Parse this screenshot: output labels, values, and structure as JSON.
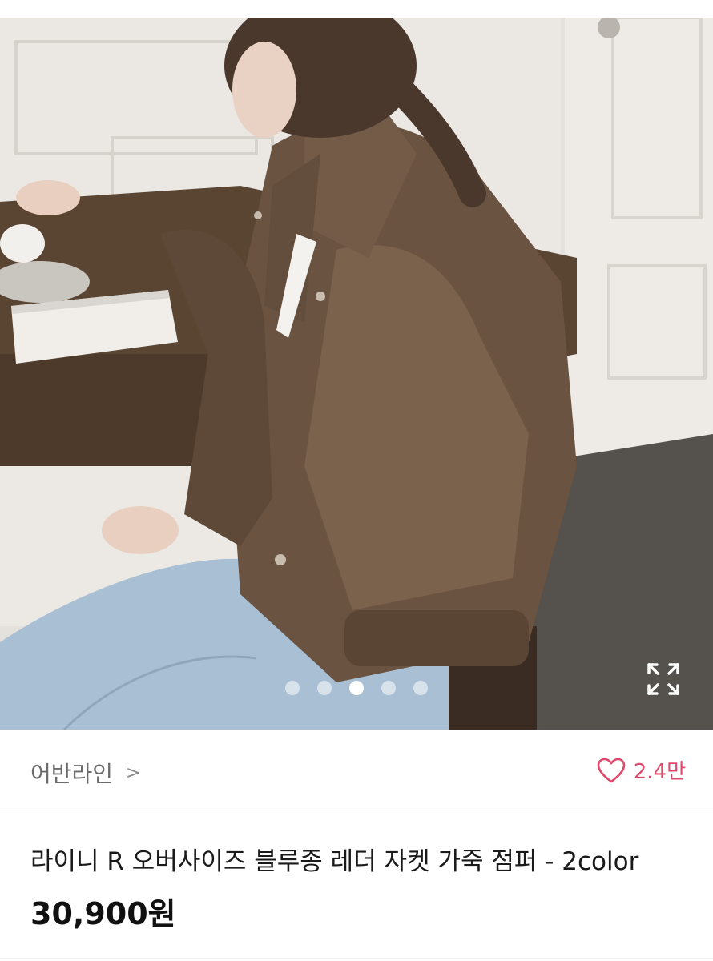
{
  "product_image": {
    "description_icon": "fashion-photo",
    "carousel": {
      "total": 5,
      "active_index": 2
    },
    "expand_icon": "expand-icon"
  },
  "seller": {
    "name": "어반라인",
    "chevron": ">"
  },
  "likes": {
    "count": "2.4만",
    "icon": "heart-icon",
    "color": "#e0496b"
  },
  "product": {
    "title": "라이니 R 오버사이즈 블루종 레더 자켓 가죽 점퍼 - 2color",
    "price": "30,900원"
  }
}
